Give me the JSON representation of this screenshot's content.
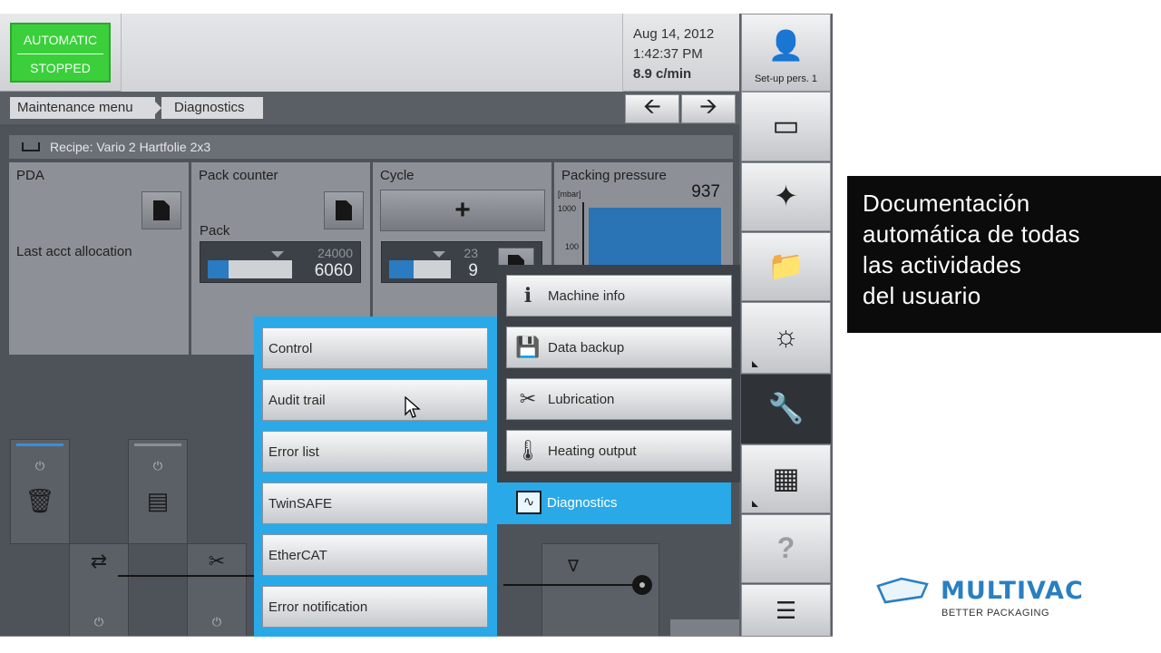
{
  "status": {
    "line1": "AUTOMATIC",
    "line2": "STOPPED",
    "color": "#3bcf3b"
  },
  "datetime": {
    "date": "Aug 14, 2012",
    "time": "1:42:37 PM",
    "rate": "8.9 c/min"
  },
  "breadcrumb": [
    "Maintenance menu",
    "Diagnostics"
  ],
  "nav": {
    "back_icon": "arrow-left-icon",
    "forward_icon": "arrow-right-icon"
  },
  "recipe": {
    "label": "Recipe: Vario 2 Hartfolie 2x3"
  },
  "tiles": {
    "pda": {
      "title": "PDA",
      "text": "Last acct allocation"
    },
    "pack_counter": {
      "title": "Pack counter",
      "sub_label": "Pack",
      "max": "24000",
      "value": "6060",
      "fill": 0.25
    },
    "cycle": {
      "title": "Cycle",
      "plus": "+",
      "max": "23",
      "value": "9",
      "fill": 0.39
    },
    "packing_pressure": {
      "title": "Packing pressure",
      "value": "937",
      "unit": "[mbar]",
      "tick_top": "1000",
      "tick_mid": "100"
    }
  },
  "menu_left": {
    "items": [
      "Control",
      "Audit trail",
      "Error list",
      "TwinSAFE",
      "EtherCAT",
      "Error notification"
    ]
  },
  "menu_right": {
    "items": [
      {
        "label": "Machine info",
        "icon": "machine-info-icon"
      },
      {
        "label": "Data backup",
        "icon": "data-backup-icon"
      },
      {
        "label": "Lubrication",
        "icon": "oil-can-icon"
      },
      {
        "label": "Heating output",
        "icon": "heating-icon"
      }
    ],
    "active": {
      "label": "Diagnostics",
      "icon": "diagnostics-icon"
    }
  },
  "sidebar": {
    "setup_label": "Set-up pers. 1",
    "items": [
      "tray-icon",
      "magic-wand-icon",
      "folder-icon",
      "gauge-icon",
      "wrench-icon",
      "bar-chart-icon",
      "help-icon",
      "list-icon"
    ],
    "active": "wrench-icon",
    "accent": "#2aa9e8"
  },
  "caption": {
    "lines": [
      "Documentación",
      "automática de todas",
      "las actividades",
      "del usuario"
    ]
  },
  "brand": {
    "name": "MULTIVAC",
    "tagline": "BETTER PACKAGING",
    "color": "#2a7fc1"
  }
}
